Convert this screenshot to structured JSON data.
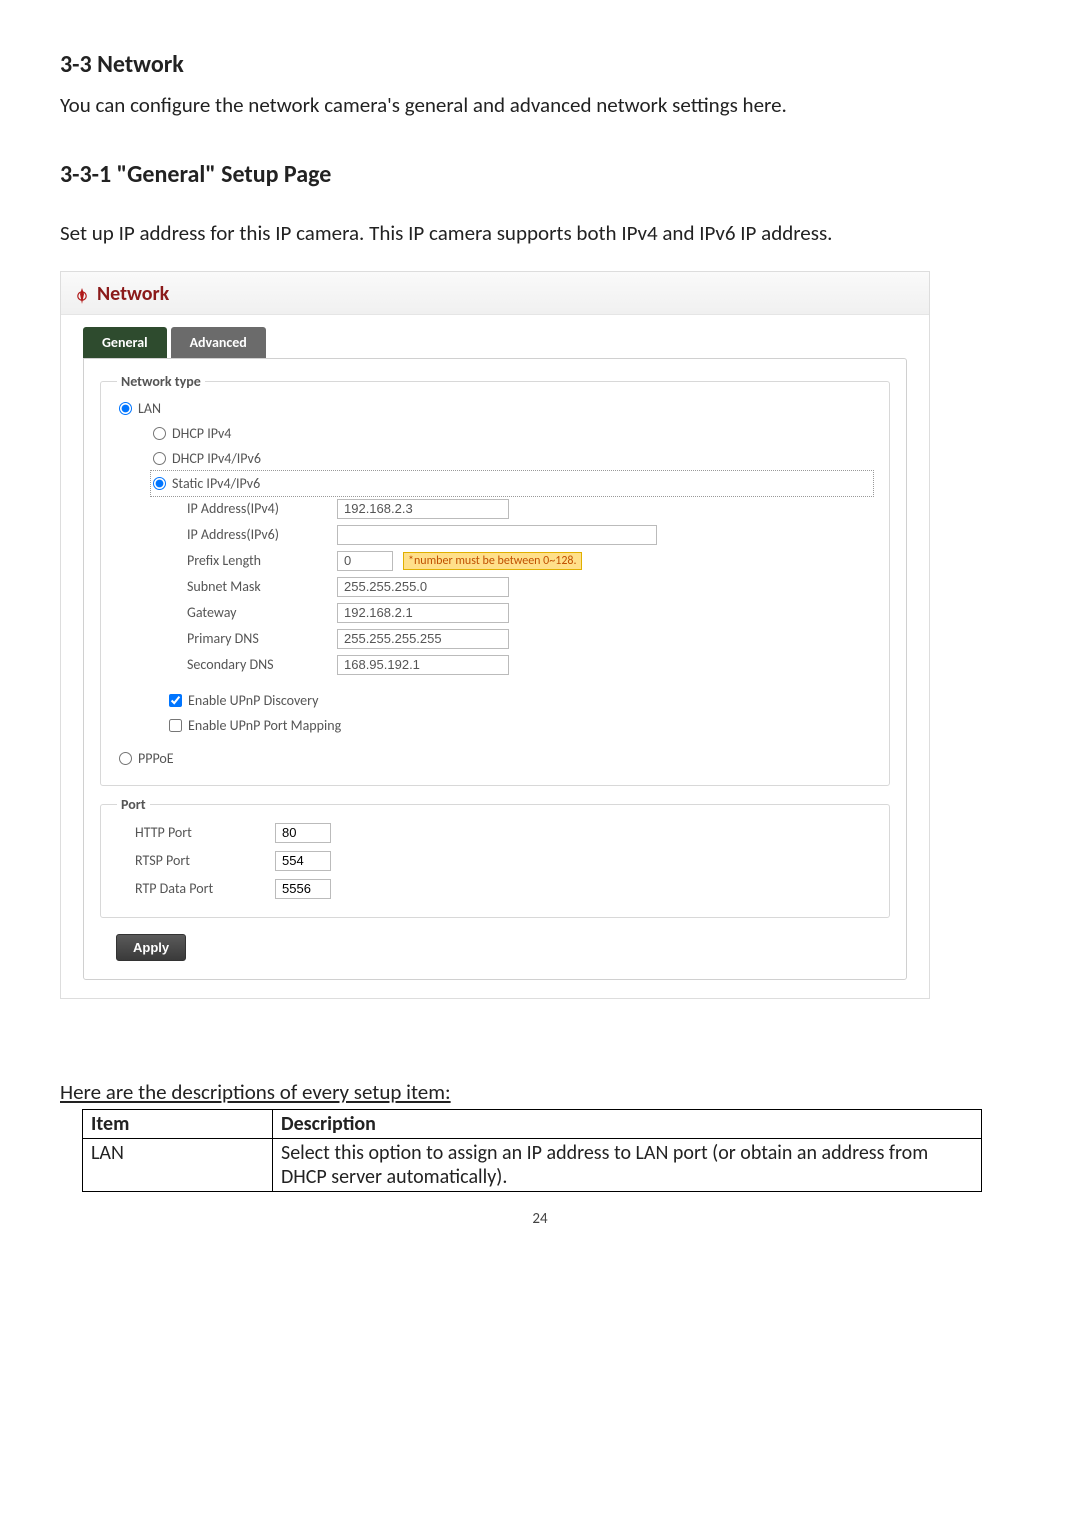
{
  "doc": {
    "h1": "3-3 Network",
    "intro": "You can configure the network camera's general and advanced network settings here.",
    "h2": "3-3-1 \"General\" Setup Page",
    "lead": "Set up IP address for this IP camera. This IP camera supports both IPv4 and IPv6 IP address.",
    "descriptions_lead": "Here are the descriptions of every setup item:",
    "table": {
      "head_item": "Item",
      "head_desc": "Description",
      "rows": [
        {
          "item": "LAN",
          "desc": "Select this option to assign an IP address to LAN port (or obtain an address from DHCP server automatically)."
        }
      ]
    },
    "page_number": "24"
  },
  "panel": {
    "title": "Network",
    "tabs": {
      "general": "General",
      "advanced": "Advanced"
    },
    "network_type": {
      "legend": "Network type",
      "lan_label": "LAN",
      "dhcp4_label": "DHCP IPv4",
      "dhcp46_label": "DHCP IPv4/IPv6",
      "static_label": "Static IPv4/IPv6",
      "fields": {
        "ipv4_label": "IP Address(IPv4)",
        "ipv4_value": "192.168.2.3",
        "ipv6_label": "IP Address(IPv6)",
        "ipv6_value": "",
        "prefix_label": "Prefix Length",
        "prefix_value": "0",
        "prefix_hint": "*number must be between 0~128.",
        "subnet_label": "Subnet Mask",
        "subnet_value": "255.255.255.0",
        "gateway_label": "Gateway",
        "gateway_value": "192.168.2.1",
        "dns1_label": "Primary DNS",
        "dns1_value": "255.255.255.255",
        "dns2_label": "Secondary DNS",
        "dns2_value": "168.95.192.1"
      },
      "upnp_discovery_label": "Enable UPnP Discovery",
      "upnp_portmap_label": "Enable UPnP Port Mapping",
      "pppoe_label": "PPPoE"
    },
    "port": {
      "legend": "Port",
      "http_label": "HTTP Port",
      "http_value": "80",
      "rtsp_label": "RTSP Port",
      "rtsp_value": "554",
      "rtp_label": "RTP Data Port",
      "rtp_value": "5556"
    },
    "apply_label": "Apply"
  }
}
